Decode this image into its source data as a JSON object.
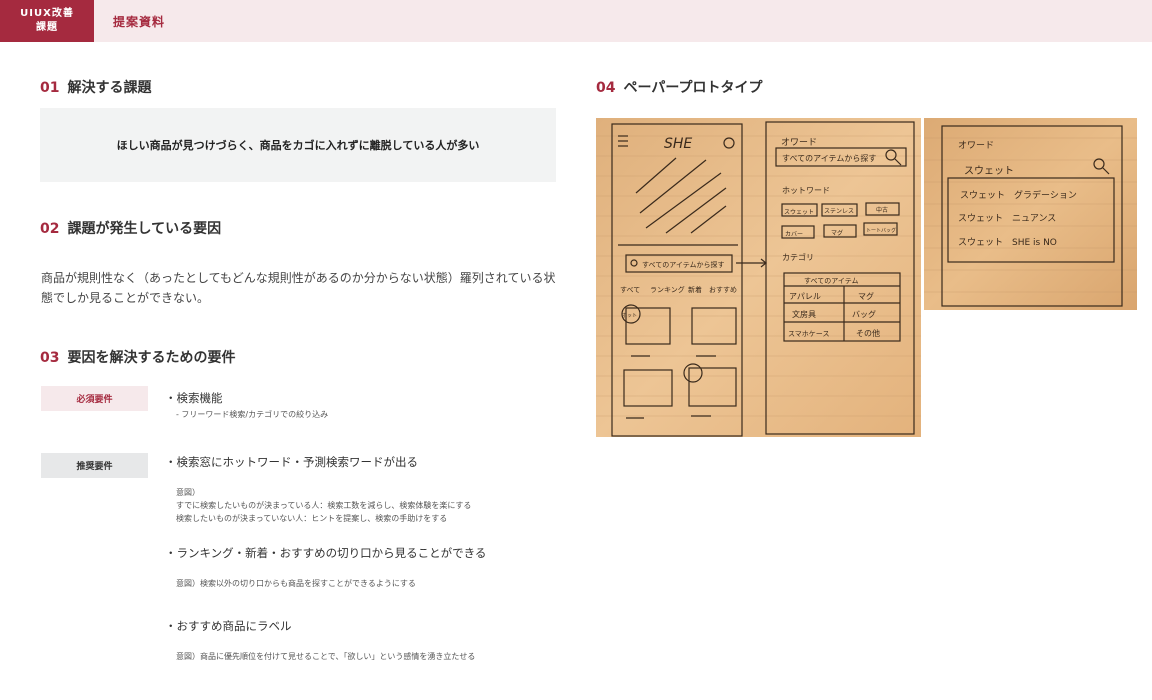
{
  "header": {
    "badge_line1": "UIUX改善",
    "badge_line2": "課題",
    "title": "提案資料"
  },
  "section1": {
    "num": "01",
    "title": "解決する課題",
    "problem": "ほしい商品が見つけづらく、商品をカゴに入れずに離脱している人が多い"
  },
  "section2": {
    "num": "02",
    "title": "課題が発生している要因",
    "body": "商品が規則性なく（あったとしてもどんな規則性があるのか分からない状態）羅列されている状態でしか見ることができない。"
  },
  "section3": {
    "num": "03",
    "title": "要因を解決するための要件",
    "must_label": "必須要件",
    "rec_label": "推奨要件",
    "must_items": [
      {
        "title": "・検索機能",
        "note": "- フリーワード検索/カテゴリでの絞り込み"
      }
    ],
    "rec_items": [
      {
        "title": "・検索窓にホットワード・予測検索ワードが出る",
        "note_1": "意図）",
        "note_2": "すでに検索したいものが決まっている人：検索工数を減らし、検索体験を楽にする",
        "note_3": "検索したいものが決まっていない人：ヒントを提案し、検索の手助けをする"
      },
      {
        "title": "・ランキング・新着・おすすめの切り口から見ることができる",
        "note": "意図）検索以外の切り口からも商品を探すことができるようにする"
      },
      {
        "title": "・おすすめ商品にラベル",
        "note": "意図）商品に優先順位を付けて見せることで、「欲しい」という感情を湧き立たせる"
      }
    ]
  },
  "section4": {
    "num": "04",
    "title": "ペーパープロトタイプ",
    "sketch_left": {
      "logo": "SHE",
      "search": "すべてのアイテムから探す",
      "tabs": [
        "すべて",
        "ランキング",
        "新着",
        "おすすめ"
      ],
      "hot_label": "ホット",
      "hotword_label": "オワード",
      "search_right": "すべてのアイテムから探す",
      "hotword_title": "ホットワード",
      "hotwords": [
        "スウェット",
        "ステンレス",
        "中古",
        "カバー",
        "マグ",
        "トートバッグ"
      ],
      "category_title": "カテゴリ",
      "categories": [
        "すべてのアイテム",
        "アパレル",
        "マグ",
        "文房具",
        "バッグ",
        "スマホケース",
        "その他"
      ]
    },
    "sketch_right": {
      "label": "オワード",
      "query": "スウェット",
      "suggestions": [
        "スウェット　グラデーション",
        "スウェット　ニュアンス",
        "スウェット　SHE is NO"
      ]
    }
  }
}
